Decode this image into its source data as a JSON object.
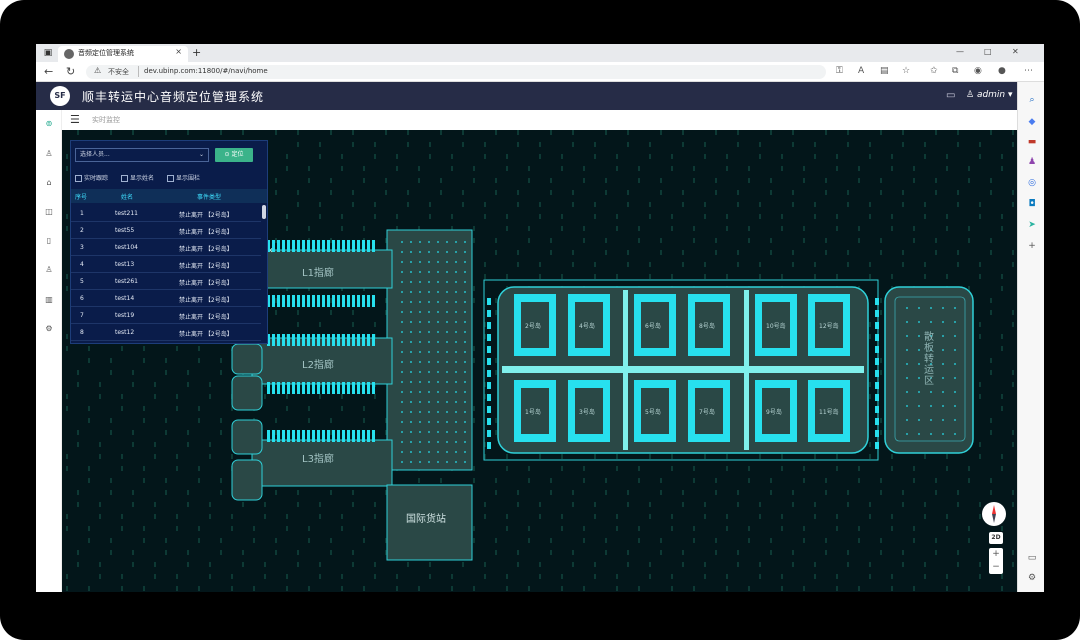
{
  "browser": {
    "tab_title": "音频定位管理系统",
    "insecure_label": "不安全",
    "url": "dev.ubinp.com:11800/#/navi/home"
  },
  "header": {
    "logo": "SF",
    "title": "顺丰转运中心音频定位管理系统",
    "user": "admin"
  },
  "breadcrumb": "实时监控",
  "panel": {
    "select_placeholder": "选择人员...",
    "locate_button": "定位",
    "options": [
      "实时跟踪",
      "显示姓名",
      "显示围栏"
    ],
    "columns": [
      "序号",
      "姓名",
      "事件类型"
    ],
    "rows": [
      {
        "no": "1",
        "name": "test211",
        "event": "禁止离开 【2号岛】"
      },
      {
        "no": "2",
        "name": "test55",
        "event": "禁止离开 【2号岛】"
      },
      {
        "no": "3",
        "name": "test104",
        "event": "禁止离开 【2号岛】"
      },
      {
        "no": "4",
        "name": "test13",
        "event": "禁止离开 【2号岛】"
      },
      {
        "no": "5",
        "name": "test261",
        "event": "禁止离开 【2号岛】"
      },
      {
        "no": "6",
        "name": "test14",
        "event": "禁止离开 【2号岛】"
      },
      {
        "no": "7",
        "name": "test19",
        "event": "禁止离开 【2号岛】"
      },
      {
        "no": "8",
        "name": "test12",
        "event": "禁止离开 【2号岛】"
      }
    ]
  },
  "map": {
    "corridors": [
      "L1指廊",
      "L2指廊",
      "L3指廊"
    ],
    "intl_station": "国际货站",
    "bulk_area": "散板转运区",
    "islands_top": [
      "2号岛",
      "4号岛",
      "6号岛",
      "8号岛",
      "10号岛",
      "12号岛"
    ],
    "islands_bottom": [
      "1号岛",
      "3号岛",
      "5号岛",
      "7号岛",
      "9号岛",
      "11号岛"
    ],
    "view_mode": "2D",
    "zoom_in": "+",
    "zoom_out": "−"
  },
  "colors": {
    "header_bg": "#262c47",
    "map_bg": "#03161a",
    "accent_cyan": "#27e0ee",
    "locate_green": "#3bb38a"
  }
}
